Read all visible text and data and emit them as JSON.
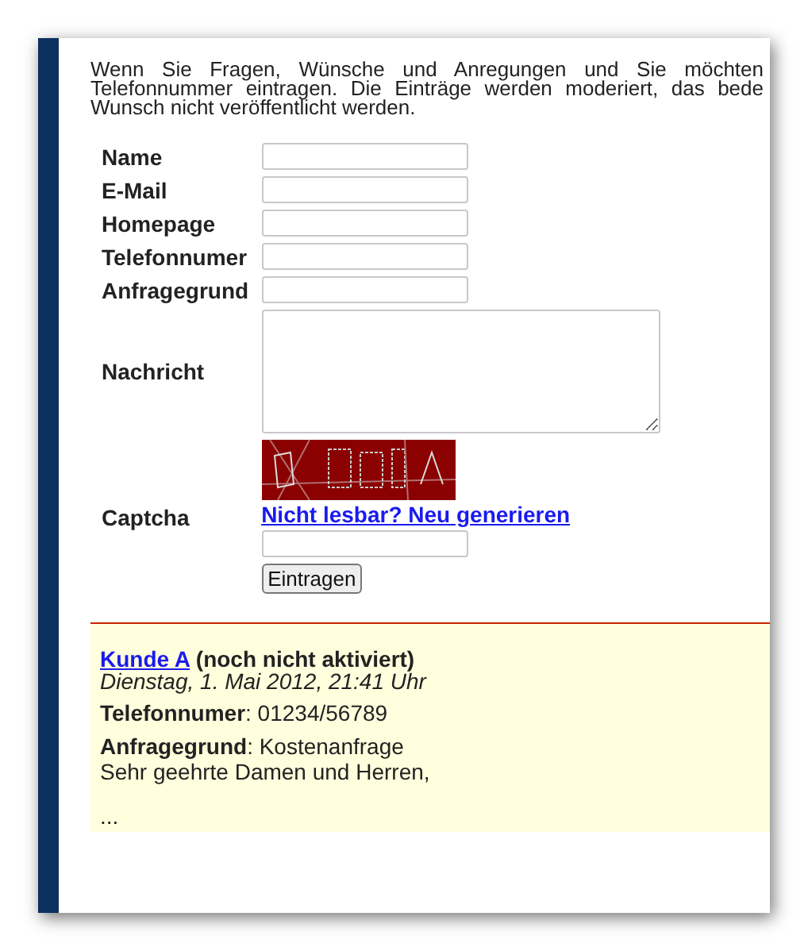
{
  "intro_lines": [
    "Wenn Sie Fragen, Wünsche und Anregungen und Sie möchten",
    "Telefonnummer eintragen. Die Einträge werden moderiert, das bede",
    "Wunsch nicht veröffentlicht werden."
  ],
  "form": {
    "fields": [
      {
        "label": "Name",
        "kind": "input"
      },
      {
        "label": "E-Mail",
        "kind": "input"
      },
      {
        "label": "Homepage",
        "kind": "input"
      },
      {
        "label": "Telefonnumer",
        "kind": "input"
      },
      {
        "label": "Anfragegrund",
        "kind": "input"
      },
      {
        "label": "Nachricht",
        "kind": "textarea"
      },
      {
        "label": "Captcha",
        "kind": "captcha",
        "link": "Nicht lesbar? Neu generieren",
        "button": "Eintragen"
      }
    ]
  },
  "entry": {
    "name": "Kunde A",
    "status": "(noch nicht aktiviert)",
    "date": "Dienstag, 1. Mai 2012, 21:41 Uhr",
    "details": [
      {
        "label": "Telefonnumer",
        "value": ": 01234/56789"
      },
      {
        "label": "Anfragegrund",
        "value": ": Kostenanfrage"
      }
    ],
    "message": [
      "Sehr geehrte Damen und Herren,",
      "..."
    ]
  }
}
